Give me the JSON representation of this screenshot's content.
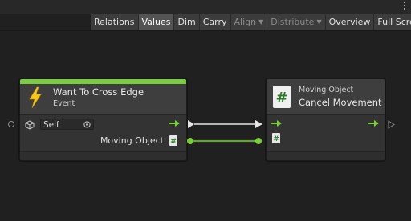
{
  "toolbar": {
    "buttons": [
      {
        "label": "Relations",
        "state": "normal"
      },
      {
        "label": "Values",
        "state": "active"
      },
      {
        "label": "Dim",
        "state": "normal"
      },
      {
        "label": "Carry",
        "state": "normal"
      },
      {
        "label": "Align",
        "state": "disabled",
        "dropdown": true
      },
      {
        "label": "Distribute",
        "state": "disabled",
        "dropdown": true
      },
      {
        "label": "Overview",
        "state": "normal"
      },
      {
        "label": "Full Screen",
        "state": "normal"
      }
    ]
  },
  "nodes": {
    "event": {
      "title": "Want To Cross Edge",
      "subtitle": "Event",
      "icon": "lightning-bolt-icon",
      "accent_color": "#7ccd3e",
      "self_value": "Self",
      "output_label": "Moving Object"
    },
    "unit": {
      "subtitle": "Moving Object",
      "title": "Cancel Movement",
      "icon": "hash-script-icon"
    }
  },
  "colors": {
    "canvas": "#202020",
    "node_body": "#333333",
    "flow_green": "#7ccd3e",
    "flow_edge_white": "#e6e6e6",
    "value_edge_green": "#5fa82e"
  }
}
